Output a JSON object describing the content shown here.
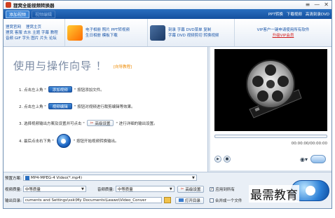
{
  "window": {
    "title": "狸窝全能视频转换器",
    "controls": [
      "≡",
      "—",
      "✕"
    ]
  },
  "menubar": {
    "tabs": [
      {
        "label": "添加视频",
        "active": true
      },
      {
        "label": "视频编辑",
        "active": false
      }
    ],
    "links": [
      "PPT转换",
      "下载视频",
      "高清刻录DVD"
    ]
  },
  "promo": {
    "box1": {
      "line1": "狸窝官网",
      "line1b": "狸窝主页",
      "line2": "狸窝 客服 去水 主题 字幕 教程",
      "line3": "音频 GIF 字头 图片 片头 论坛"
    },
    "box2": {
      "line1": "电子相册 照片 PPT转视频",
      "line2": "生日相册 模板下载"
    },
    "box3": {
      "line1": "刻录 字幕 DVD菜单 复制",
      "line2": "字幕 DVD 视频剪切 转换视频"
    },
    "box4": {
      "line1": "VIP客户一键申请使用所有软件",
      "line2": "升级VIP会员"
    }
  },
  "wizard": {
    "title": "使用与操作向导 ！",
    "subtitle": "[向导教程]",
    "steps": [
      {
        "num": "1. 点击左上角 \"",
        "button": "添加视频",
        "after": "\" 按钮添加文件。"
      },
      {
        "num": "2. 点击左上角 \"",
        "button": "视频编辑",
        "after": "\" 按钮对视频进行裁剪编辑等效果。"
      },
      {
        "num": "3. 选择视频输出方案及设置并可点击 \"",
        "button": "高级设置",
        "after": "\" 进行详细的输出设置。"
      },
      {
        "num": "4. 最后点击右下角 \"",
        "after": "\" 按钮开始视频转换输出。"
      }
    ]
  },
  "preview": {
    "timecode": "00:00:00/00:00:00"
  },
  "bottom": {
    "profile_label": "预置方案:",
    "profile_value": "MP4-MPEG-4 Video(*.mp4)",
    "video_quality_label": "视频质量:",
    "video_quality_value": "中等质量",
    "audio_quality_label": "音频质量:",
    "audio_quality_value": "中等质量",
    "advanced_label": "高级设置",
    "apply_all_label": "应用到所有",
    "output_label": "输出目录:",
    "output_value": "cuments and Settings\\ssk\\My Documents\\Leawo\\Video_Conver",
    "open_dir_label": "打开目录",
    "merge_label": "合并成一个文件"
  },
  "watermark": "最需教育"
}
